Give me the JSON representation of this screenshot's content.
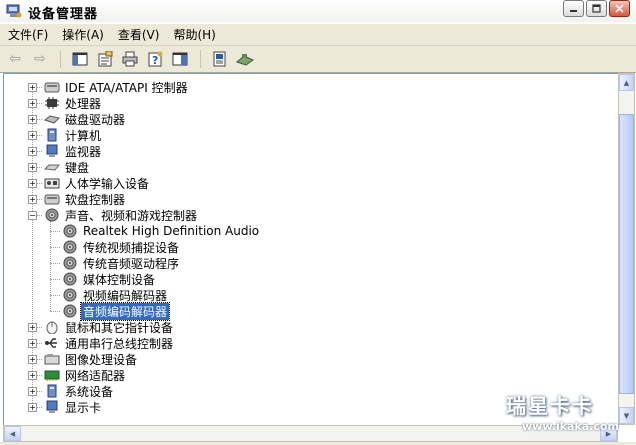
{
  "window": {
    "title": "设备管理器"
  },
  "menu": [
    {
      "label": "文件(F)"
    },
    {
      "label": "操作(A)"
    },
    {
      "label": "查看(V)"
    },
    {
      "label": "帮助(H)"
    }
  ],
  "toolbar": {
    "icons": [
      "back-arrow-icon",
      "forward-arrow-icon",
      "properties-view-icon",
      "driver-icon",
      "print-icon",
      "help-icon",
      "console-tree-icon",
      "scan-hardware-icon",
      "network-icon"
    ]
  },
  "tree": {
    "items": [
      {
        "label": "IDE ATA/ATAPI 控制器",
        "level": 1,
        "expander": "+",
        "icon": "ide-controller-icon"
      },
      {
        "label": "处理器",
        "level": 1,
        "expander": "+",
        "icon": "processor-icon"
      },
      {
        "label": "磁盘驱动器",
        "level": 1,
        "expander": "+",
        "icon": "disk-drive-icon"
      },
      {
        "label": "计算机",
        "level": 1,
        "expander": "+",
        "icon": "computer-icon"
      },
      {
        "label": "监视器",
        "level": 1,
        "expander": "+",
        "icon": "monitor-icon"
      },
      {
        "label": "键盘",
        "level": 1,
        "expander": "+",
        "icon": "keyboard-icon"
      },
      {
        "label": "人体学输入设备",
        "level": 1,
        "expander": "+",
        "icon": "hid-icon"
      },
      {
        "label": "软盘控制器",
        "level": 1,
        "expander": "+",
        "icon": "floppy-controller-icon"
      },
      {
        "label": "声音、视频和游戏控制器",
        "level": 1,
        "expander": "−",
        "icon": "sound-icon"
      },
      {
        "label": "Realtek High Definition Audio",
        "level": 2,
        "icon": "sound-icon"
      },
      {
        "label": "传统视频捕捉设备",
        "level": 2,
        "icon": "sound-icon"
      },
      {
        "label": "传统音频驱动程序",
        "level": 2,
        "icon": "sound-icon"
      },
      {
        "label": "媒体控制设备",
        "level": 2,
        "icon": "sound-icon"
      },
      {
        "label": "视频编码解码器",
        "level": 2,
        "icon": "sound-icon"
      },
      {
        "label": "音频编码解码器",
        "level": 2,
        "icon": "sound-icon",
        "selected": true
      },
      {
        "label": "鼠标和其它指针设备",
        "level": 1,
        "expander": "+",
        "icon": "mouse-icon"
      },
      {
        "label": "通用串行总线控制器",
        "level": 1,
        "expander": "+",
        "icon": "usb-icon"
      },
      {
        "label": "图像处理设备",
        "level": 1,
        "expander": "+",
        "icon": "imaging-device-icon"
      },
      {
        "label": "网络适配器",
        "level": 1,
        "expander": "+",
        "icon": "network-adapter-icon"
      },
      {
        "label": "系统设备",
        "level": 1,
        "expander": "+",
        "icon": "system-device-icon"
      },
      {
        "label": "显示卡",
        "level": 1,
        "expander": "+",
        "icon": "display-adapter-icon"
      }
    ]
  },
  "watermark": {
    "title": "瑞星卡卡",
    "url": "www.ikaka.com"
  },
  "colors": {
    "selection": "#316ac5",
    "chrome": "#ece9d8",
    "close": "#d7573c"
  }
}
